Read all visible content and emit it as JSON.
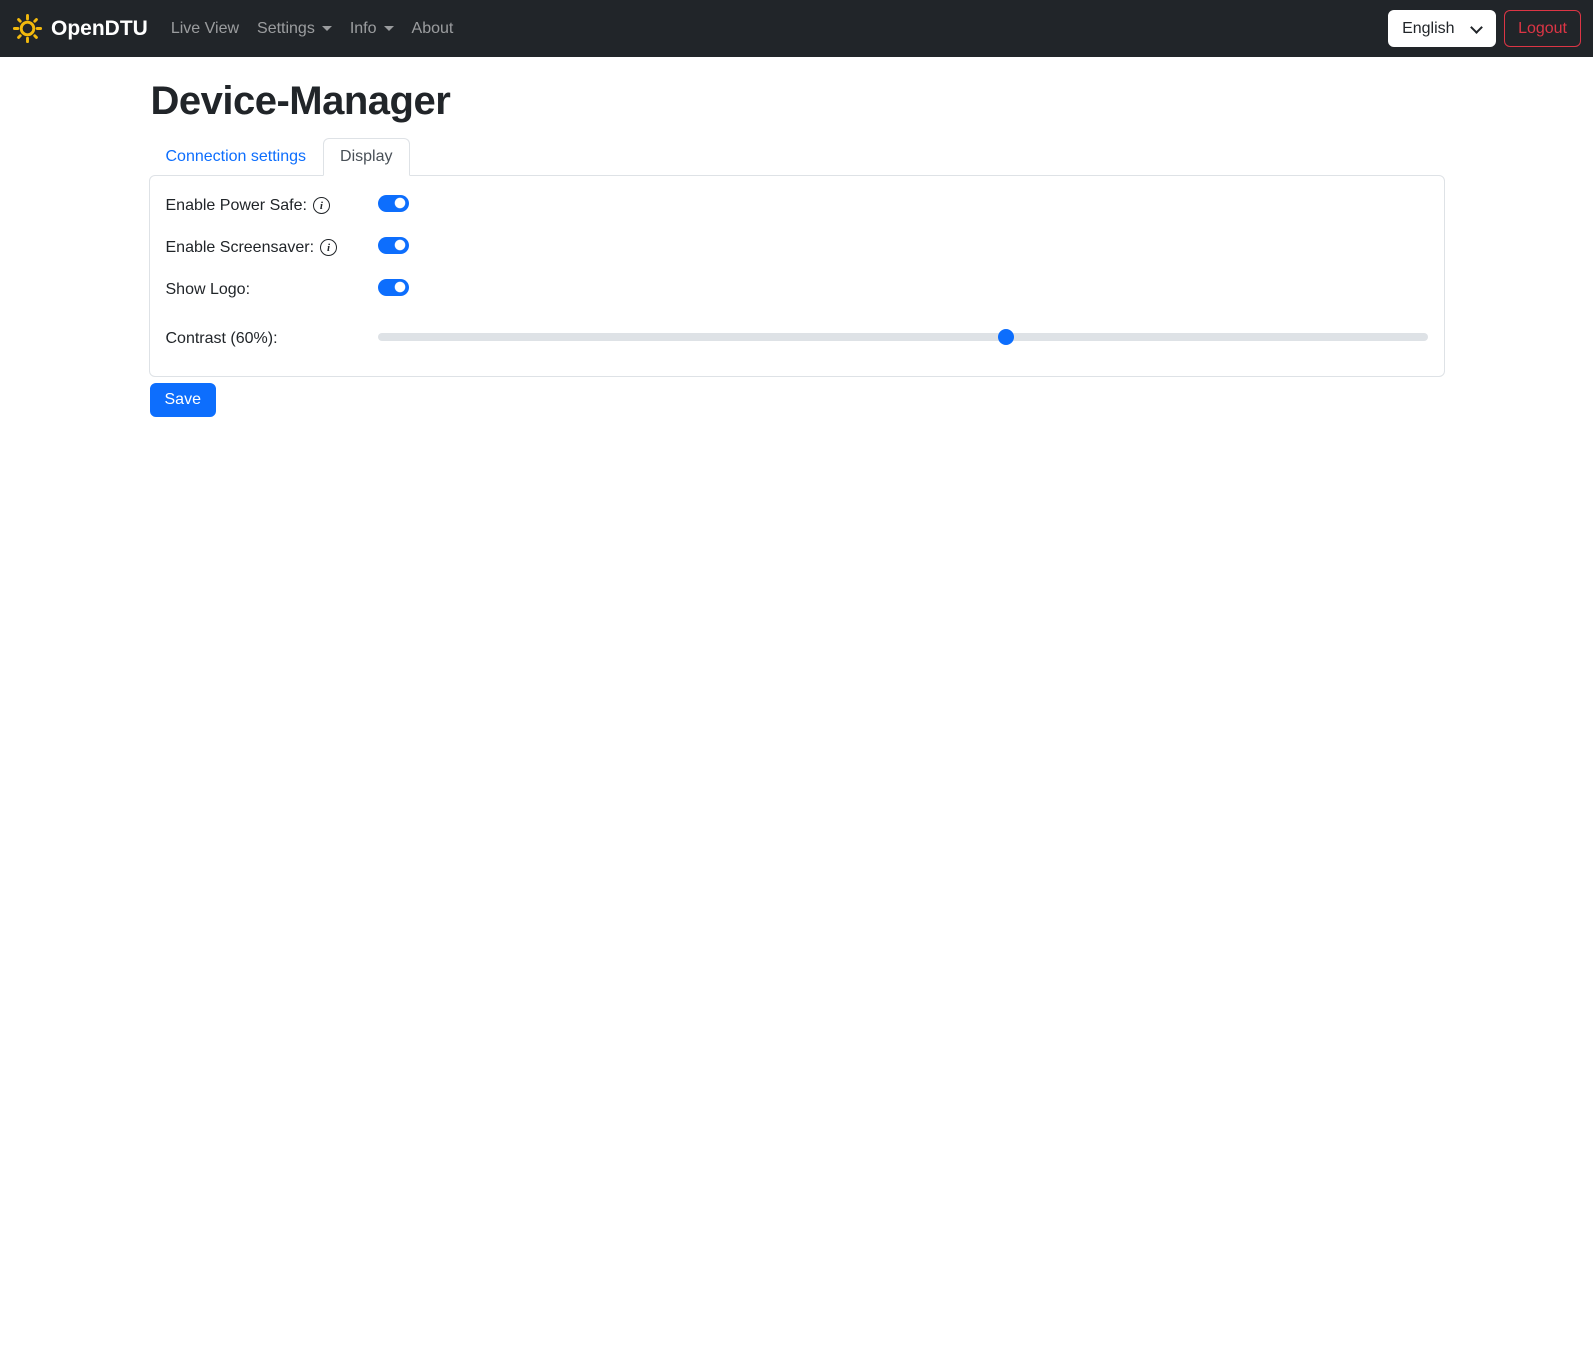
{
  "navbar": {
    "brand": "OpenDTU",
    "items": [
      {
        "label": "Live View",
        "dropdown": false
      },
      {
        "label": "Settings",
        "dropdown": true
      },
      {
        "label": "Info",
        "dropdown": true
      },
      {
        "label": "About",
        "dropdown": false
      }
    ],
    "language_selected": "English",
    "logout_label": "Logout"
  },
  "page": {
    "title": "Device-Manager"
  },
  "tabs": [
    {
      "label": "Connection settings",
      "active": false
    },
    {
      "label": "Display",
      "active": true
    }
  ],
  "form": {
    "rows": [
      {
        "label": "Enable Power Safe:",
        "info": true,
        "type": "switch",
        "enabled": true
      },
      {
        "label": "Enable Screensaver:",
        "info": true,
        "type": "switch",
        "enabled": true
      },
      {
        "label": "Show Logo:",
        "info": false,
        "type": "switch",
        "enabled": true
      },
      {
        "label": "Contrast (60%):",
        "info": false,
        "type": "range",
        "value": 60
      }
    ],
    "save_label": "Save"
  },
  "colors": {
    "accent": "#0d6efd",
    "navbar_bg": "#212529",
    "danger": "#dc3545",
    "border": "#dee2e6",
    "brand_icon": "#f2b90d",
    "inactive_tab_link": "#0d6efd",
    "active_tab_text": "#495057"
  }
}
